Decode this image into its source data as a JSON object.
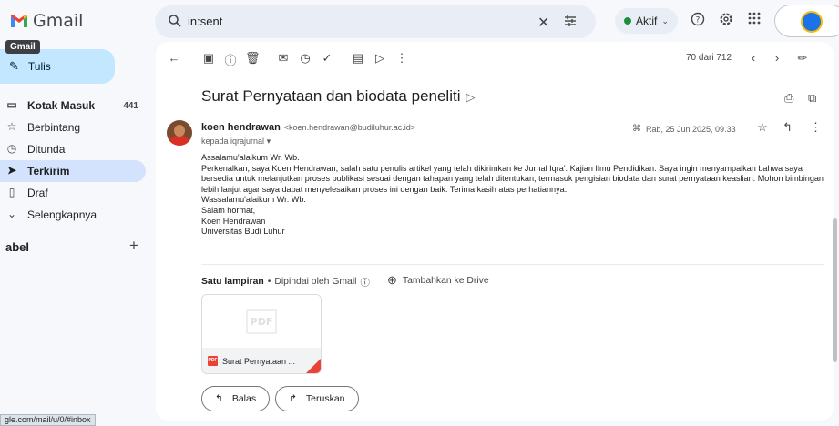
{
  "header": {
    "app_name": "Gmail",
    "search_value": "in:sent",
    "status_label": "Aktif",
    "icons": [
      "search-icon",
      "clear-icon",
      "tune-icon",
      "help-icon",
      "settings-icon",
      "apps-icon",
      "account-avatar"
    ]
  },
  "sidebar": {
    "tooltip": "Gmail",
    "compose_label": "Tulis",
    "items": [
      {
        "label": "Kotak Masuk",
        "count": "441",
        "icon": "inbox-icon"
      },
      {
        "label": "Berbintang",
        "count": "",
        "icon": "star-icon"
      },
      {
        "label": "Ditunda",
        "count": "",
        "icon": "clock-icon"
      },
      {
        "label": "Terkirim",
        "count": "",
        "icon": "send-icon"
      },
      {
        "label": "Draf",
        "count": "",
        "icon": "draft-icon"
      },
      {
        "label": "Selengkapnya",
        "count": "",
        "icon": "chevron-down-icon"
      }
    ],
    "labels_header": "abel",
    "status_url": "gle.com/mail/u/0/#inbox"
  },
  "toolbar": {
    "pager": "70 dari 712"
  },
  "email": {
    "subject": "Surat Pernyataan dan biodata peneliti",
    "sender_name": "koen hendrawan",
    "sender_email": "<koen.hendrawan@budiluhur.ac.id>",
    "to_line": "kepada iqrajurnal",
    "date": "Rab, 25 Jun 2025, 09.33",
    "body": [
      "Assalamu'alaikum Wr. Wb.",
      "Perkenalkan, saya Koen Hendrawan, salah satu penulis artikel yang telah dikirimkan ke Jurnal Iqra': Kajian Ilmu Pendidikan. Saya ingin menyampaikan bahwa saya bersedia untuk melanjutkan proses publikasi sesuai dengan tahapan yang telah ditentukan, termasuk pengisian biodata dan surat pernyataan keaslian. Mohon bimbingan lebih lanjut agar saya dapat menyelesaikan proses ini dengan baik. Terima kasih atas perhatiannya.",
      "Wassalamu'alaikum Wr. Wb.",
      "Salam hormat,",
      "Koen Hendrawan",
      "Universitas Budi Luhur"
    ],
    "attachment_count": "Satu lampiran",
    "scanned_by": "Dipindai oleh Gmail",
    "add_to_drive": "Tambahkan ke Drive",
    "attachment_name": "Surat Pernyataan ...",
    "attachment_thumb": "PDF",
    "pdf_badge": "PDF",
    "reply_label": "Balas",
    "forward_label": "Teruskan"
  },
  "colors": {
    "accent": "#c2e7ff",
    "active_nav": "#d3e3fd",
    "status_green": "#1e8e3e",
    "pdf_red": "#ea4335"
  }
}
